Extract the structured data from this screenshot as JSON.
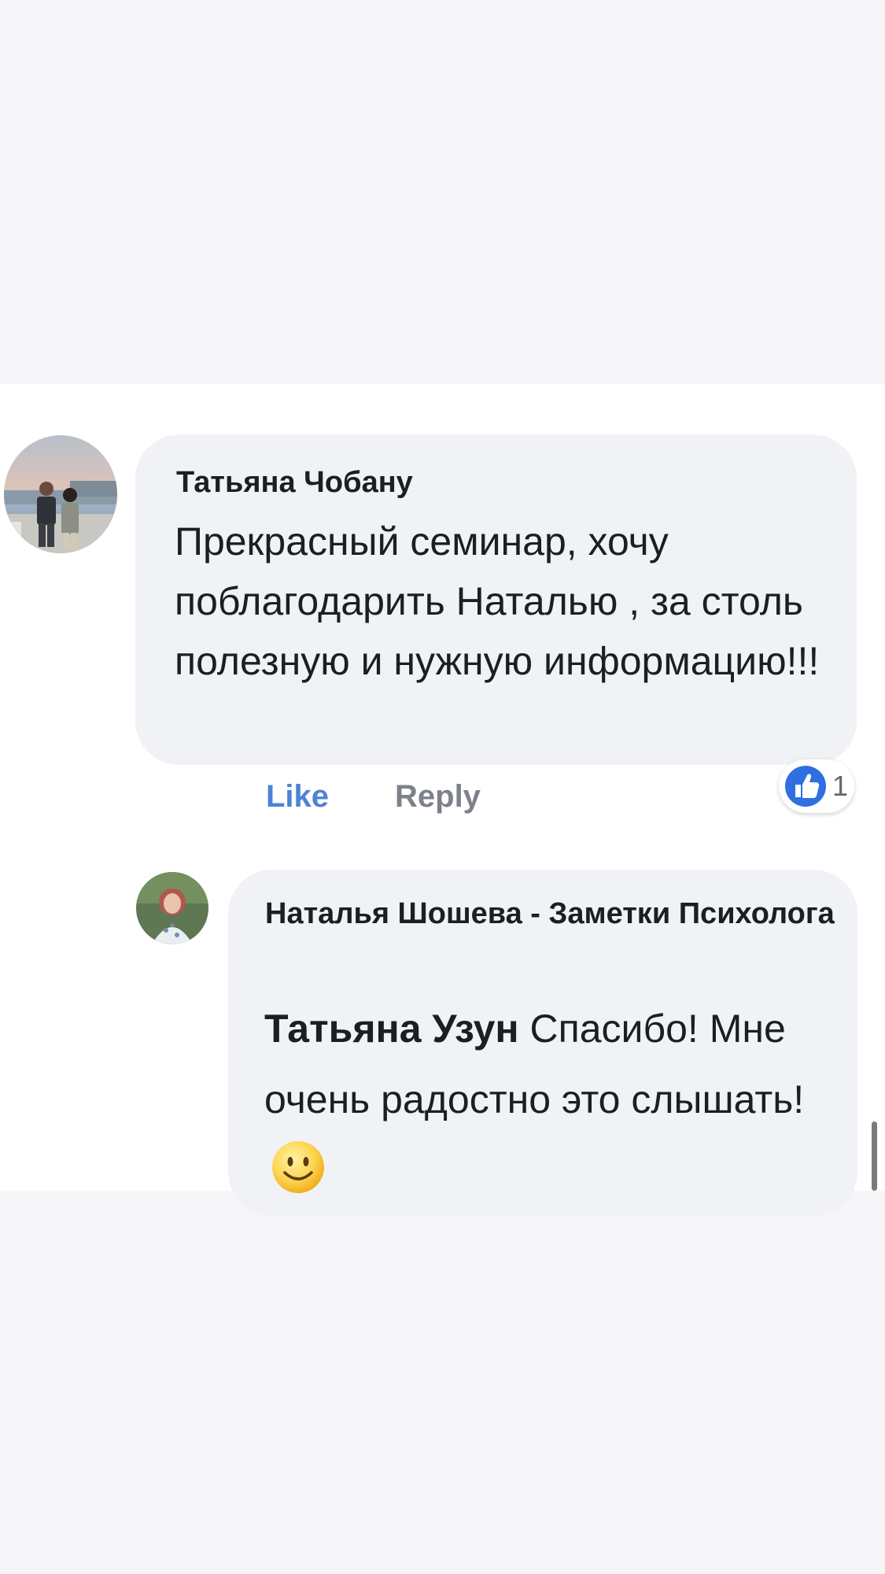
{
  "comment": {
    "author": "Татьяна Чобану",
    "text": "Прекрасный семинар, хочу поблагодарить Наталью , за столь полезную и нужную информацию!!!",
    "actions": {
      "like_label": "Like",
      "reply_label": "Reply"
    },
    "reactions": {
      "icon": "like-icon",
      "count": "1"
    }
  },
  "reply": {
    "author": "Наталья Шошева - Заметки Психолога",
    "mention": "Татьяна Узун",
    "text": "Спасибо! Мне очень радостно это слышать!",
    "emoji": "smiley-emoji"
  },
  "colors": {
    "link_blue": "#4e83d4",
    "bubble_bg": "#f0f2f5",
    "muted_text": "#7d818a",
    "like_icon_blue": "#2f6fe0",
    "emoji_yellow": "#fcd34d"
  }
}
